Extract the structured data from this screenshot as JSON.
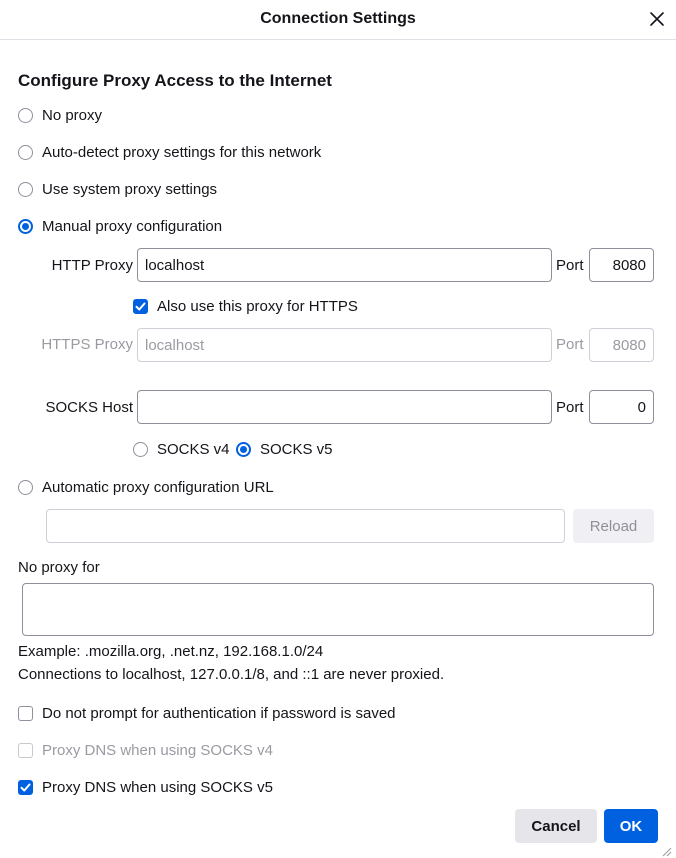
{
  "dialog": {
    "title": "Connection Settings"
  },
  "heading": "Configure Proxy Access to the Internet",
  "proxy_options": {
    "none": "No proxy",
    "auto_detect": "Auto-detect proxy settings for this network",
    "system": "Use system proxy settings",
    "manual": "Manual proxy configuration",
    "selected": "manual"
  },
  "http_proxy": {
    "label": "HTTP Proxy",
    "value": "localhost",
    "port_label": "Port",
    "port": "8080"
  },
  "also_https": {
    "label": "Also use this proxy for HTTPS",
    "checked": true
  },
  "https_proxy": {
    "label": "HTTPS Proxy",
    "value": "localhost",
    "port_label": "Port",
    "port": "8080",
    "disabled": true
  },
  "socks": {
    "label": "SOCKS Host",
    "value": "",
    "port_label": "Port",
    "port": "0",
    "v4_label": "SOCKS v4",
    "v5_label": "SOCKS v5",
    "selected": "v5"
  },
  "auto_config": {
    "label": "Automatic proxy configuration URL",
    "url": "",
    "reload_label": "Reload"
  },
  "no_proxy": {
    "label": "No proxy for",
    "value": "",
    "example": "Example: .mozilla.org, .net.nz, 192.168.1.0/24",
    "note": "Connections to localhost, 127.0.0.1/8, and ::1 are never proxied."
  },
  "options": {
    "no_prompt": {
      "label": "Do not prompt for authentication if password is saved",
      "checked": false
    },
    "dns_v4": {
      "label": "Proxy DNS when using SOCKS v4",
      "checked": false,
      "disabled": true
    },
    "dns_v5": {
      "label": "Proxy DNS when using SOCKS v5",
      "checked": true
    }
  },
  "buttons": {
    "cancel": "Cancel",
    "ok": "OK"
  },
  "colors": {
    "accent": "#0061e0",
    "border": "#8f8f9d",
    "disabled_text": "#9a9aa2"
  }
}
